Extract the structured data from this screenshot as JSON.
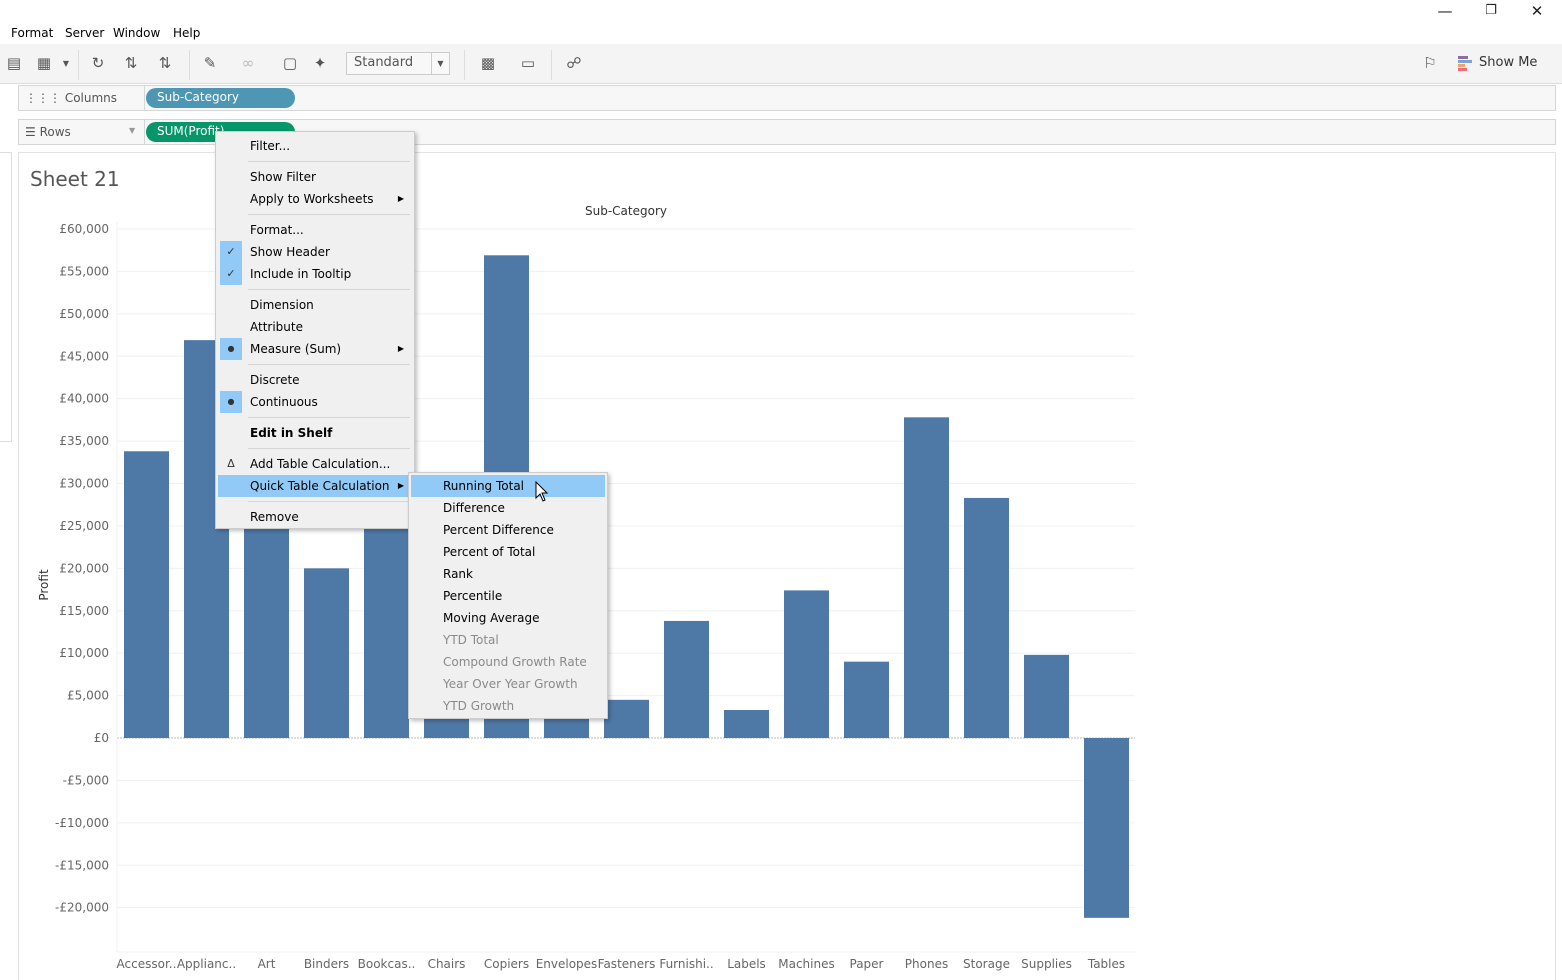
{
  "window": {
    "minimize_icon": "minimize-icon",
    "restore_icon": "restore-icon",
    "close_icon": "close-icon"
  },
  "menubar": [
    "Format",
    "Server",
    "Window",
    "Help"
  ],
  "toolbar": {
    "mark_size": "Standard",
    "show_me": "Show Me"
  },
  "shelves": {
    "columns_label": "Columns",
    "columns_pill": "Sub-Category",
    "rows_label": "Rows",
    "rows_pill": "SUM(Profit)"
  },
  "colors": {
    "columns_pill": "#4d96b4",
    "rows_pill": "#06966a",
    "bar": "#4e79a7",
    "menu_highlight": "#91c9f7"
  },
  "sheet": {
    "title": "Sheet 21"
  },
  "context_menu": [
    {
      "label": "Filter..."
    },
    {
      "sep": true
    },
    {
      "label": "Show Filter"
    },
    {
      "label": "Apply to Worksheets",
      "submenu": true
    },
    {
      "sep": true
    },
    {
      "label": "Format..."
    },
    {
      "label": "Show Header",
      "icon": "check"
    },
    {
      "label": "Include in Tooltip",
      "icon": "check"
    },
    {
      "sep": true
    },
    {
      "label": "Dimension"
    },
    {
      "label": "Attribute"
    },
    {
      "label": "Measure (Sum)",
      "icon": "dot",
      "submenu": true
    },
    {
      "sep": true
    },
    {
      "label": "Discrete"
    },
    {
      "label": "Continuous",
      "icon": "dot"
    },
    {
      "sep": true
    },
    {
      "label": "Edit in Shelf",
      "bold": true
    },
    {
      "sep": true
    },
    {
      "label": "Add Table Calculation...",
      "icon": "delta"
    },
    {
      "label": "Quick Table Calculation",
      "submenu": true,
      "highlighted": true
    },
    {
      "sep": true
    },
    {
      "label": "Remove"
    }
  ],
  "submenu": [
    {
      "label": "Running Total",
      "highlighted": true
    },
    {
      "label": "Difference"
    },
    {
      "label": "Percent Difference"
    },
    {
      "label": "Percent of Total"
    },
    {
      "label": "Rank"
    },
    {
      "label": "Percentile"
    },
    {
      "label": "Moving Average"
    },
    {
      "label": "YTD Total",
      "disabled": true
    },
    {
      "label": "Compound Growth Rate",
      "disabled": true
    },
    {
      "label": "Year Over Year Growth",
      "disabled": true
    },
    {
      "label": "YTD Growth",
      "disabled": true
    }
  ],
  "chart_data": {
    "type": "bar",
    "title": "Sub-Category",
    "xlabel": "",
    "ylabel": "Profit",
    "ylim": [
      -20000,
      60000
    ],
    "yticks": [
      "£60,000",
      "£55,000",
      "£50,000",
      "£45,000",
      "£40,000",
      "£35,000",
      "£30,000",
      "£25,000",
      "£20,000",
      "£15,000",
      "£10,000",
      "£5,000",
      "£0",
      "-£5,000",
      "-£10,000",
      "-£15,000",
      "-£20,000"
    ],
    "ytick_values": [
      60000,
      55000,
      50000,
      45000,
      40000,
      35000,
      30000,
      25000,
      20000,
      15000,
      10000,
      5000,
      0,
      -5000,
      -10000,
      -15000,
      -20000
    ],
    "grid": true,
    "categories": [
      "Accessor..",
      "Applianc..",
      "Art",
      "Binders",
      "Bookcas..",
      "Chairs",
      "Copiers",
      "Envelopes",
      "Fasteners",
      "Furnishi..",
      "Labels",
      "Machines",
      "Paper",
      "Phones",
      "Storage",
      "Supplies",
      "Tables"
    ],
    "values": [
      33800,
      46900,
      27000,
      20000,
      25500,
      26000,
      56900,
      6000,
      4500,
      13800,
      3300,
      17400,
      9000,
      37800,
      28300,
      9800,
      -21200
    ]
  }
}
